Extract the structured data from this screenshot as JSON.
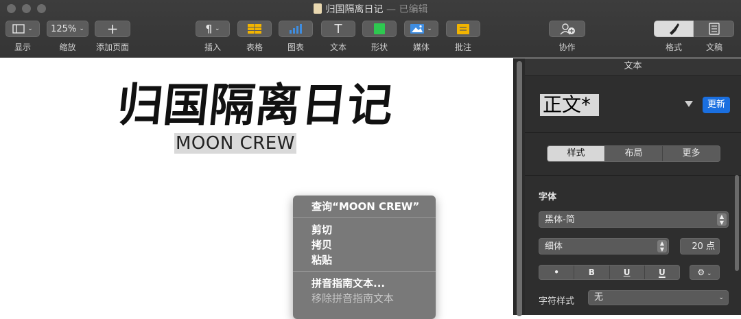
{
  "window": {
    "title": "归国隔离日记",
    "edited_suffix": "— 已编辑"
  },
  "toolbar": {
    "view_label": "显示",
    "zoom_value": "125%",
    "zoom_label": "缩放",
    "add_page_label": "添加页面",
    "insert_label": "插入",
    "table_label": "表格",
    "chart_label": "图表",
    "text_label": "文本",
    "shape_label": "形状",
    "media_label": "媒体",
    "comment_label": "批注",
    "collaborate_label": "协作",
    "format_label": "格式",
    "document_label": "文稿"
  },
  "document": {
    "title": "归国隔离日记",
    "subtitle": "MOON CREW"
  },
  "context_menu": {
    "lookup": "查询“MOON CREW”",
    "cut": "剪切",
    "copy": "拷贝",
    "paste": "粘贴",
    "pinyin": "拼音指南文本...",
    "remove_pinyin": "移除拼音指南文本"
  },
  "inspector": {
    "header": "文本",
    "paragraph_style": "正文*",
    "update_button": "更新",
    "tabs": [
      "样式",
      "布局",
      "更多"
    ],
    "font_section": "字体",
    "font_family": "黑体-简",
    "font_weight": "细体",
    "font_size": "20 点",
    "format_buttons": [
      "•",
      "B",
      "U",
      "U"
    ],
    "char_style_label": "字符样式",
    "char_style_value": "无"
  },
  "colors": {
    "accent": "#1a6fe0",
    "toolbar": "#3a3a3a",
    "inspector": "#2e2e2e"
  }
}
